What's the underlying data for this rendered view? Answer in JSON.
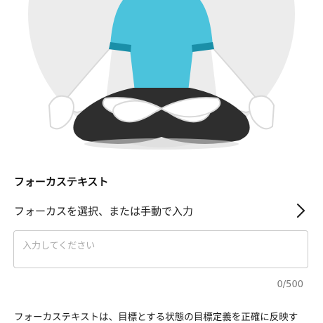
{
  "illustration": {
    "icon": "meditation-figure-icon",
    "colors": {
      "background_circle": "#ececec",
      "shirt": "#4bc3dc",
      "sleeve_band": "#1a8fa8",
      "pants": "#2e2e2e",
      "skin_outline": "#d9d9d9"
    }
  },
  "section": {
    "title": "フォーカステキスト"
  },
  "selector": {
    "label": "フォーカスを選択、または手動で入力",
    "icon": "chevron-right-icon"
  },
  "input": {
    "value": "",
    "placeholder": "入力してください"
  },
  "counter": {
    "text": "0/500"
  },
  "description": {
    "text": "フォーカステキストは、目標とする状態の目標定義を正確に反映す"
  }
}
